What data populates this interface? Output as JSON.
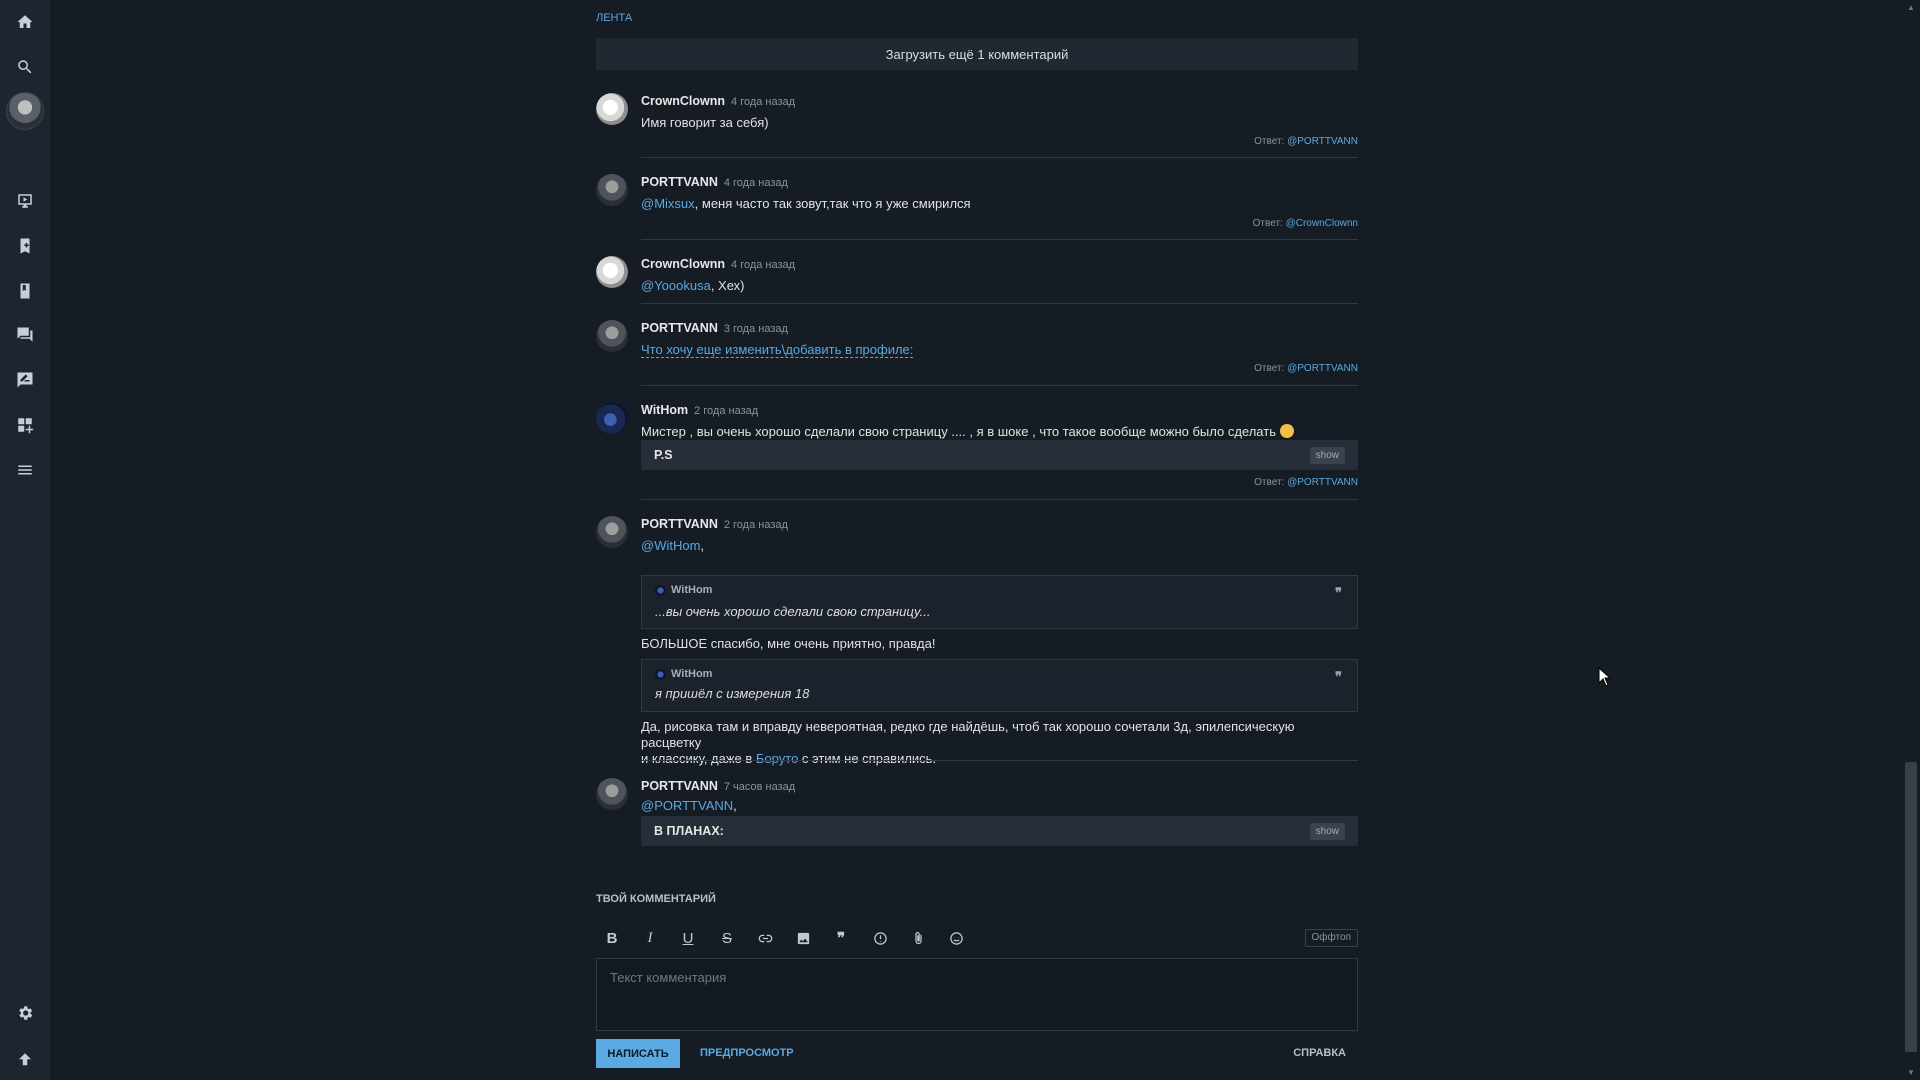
{
  "sidebar": {
    "items": [
      {
        "name": "home",
        "icon": "home-icon"
      },
      {
        "name": "search",
        "icon": "search-icon"
      },
      {
        "name": "watch",
        "icon": "tv-icon"
      },
      {
        "name": "bookmarks",
        "icon": "bookmark-icon"
      },
      {
        "name": "library",
        "icon": "book-icon"
      },
      {
        "name": "forum",
        "icon": "forum-icon"
      },
      {
        "name": "messages",
        "icon": "message-edit-icon"
      },
      {
        "name": "catalog",
        "icon": "grid-icon"
      },
      {
        "name": "menu",
        "icon": "menu-icon"
      },
      {
        "name": "settings",
        "icon": "gear-icon"
      },
      {
        "name": "scroll-top",
        "icon": "arrow-up-icon"
      }
    ]
  },
  "feed": {
    "label": "ЛЕНТА"
  },
  "load_more": "Загрузить ещё 1 комментарий",
  "comments": [
    {
      "author": "CrownClownn",
      "time": "4 года назад",
      "text": "Имя говорит за себя)",
      "reply_label": "Ответ:",
      "reply_to": "@PORTTVANN"
    },
    {
      "author": "PORTTVANN",
      "time": "4 года назад",
      "mention": "@Mixsux",
      "text": ", меня часто так зовут,так что я уже смирился",
      "reply_label": "Ответ:",
      "reply_to": "@CrownClownn"
    },
    {
      "author": "CrownClownn",
      "time": "4 года назад",
      "mention": "@Yoookusa",
      "text": ", Хех)"
    },
    {
      "author": "PORTTVANN",
      "time": "3 года назад",
      "link_text": "Что хочу еще изменить\\добавить в профиле:",
      "reply_label": "Ответ:",
      "reply_to": "@PORTTVANN"
    },
    {
      "author": "WitHom",
      "time": "2 года назад",
      "text": "Мистер , вы очень хорошо сделали свою страницу .... , я в шоке , что такое вообще можно было сделать",
      "spoiler_title": "P.S",
      "spoiler_btn": "show",
      "reply_label": "Ответ:",
      "reply_to": "@PORTTVANN"
    },
    {
      "author": "PORTTVANN",
      "time": "2 года назад",
      "mention": "@WitHom",
      "text": ",",
      "quote1": {
        "author": "WitHom",
        "text": "...вы очень хорошо сделали свою страницу..."
      },
      "text2": "БОЛЬШОЕ спасибо, мне очень приятно, правда!",
      "quote2": {
        "author": "WitHom",
        "text": "я пришёл с измерения 18"
      },
      "text3a": "Да, рисовка там и вправду невероятная, редко где найдёшь, чтоб так хорошо сочетали 3д, эпилепсическую расцветку",
      "text3b": "и классику, даже в ",
      "text3_link": "Боруто",
      "text3c": " с этим не справились."
    },
    {
      "author": "PORTTVANN",
      "time": "7 часов назад",
      "mention": "@PORTTVANN",
      "text": ",",
      "spoiler_title": "В ПЛАНАХ:",
      "spoiler_btn": "show"
    }
  ],
  "quote_mark": "❞",
  "form": {
    "title": "ТВОЙ КОММЕНТАРИЙ",
    "placeholder": "Текст комментария",
    "offtop": "Оффтоп",
    "submit": "НАПИСАТЬ",
    "preview": "ПРЕДПРОСМОТР",
    "help": "СПРАВКА",
    "toolbar": {
      "bold": "B",
      "italic": "I",
      "underline": "U",
      "strike": "S"
    }
  },
  "colors": {
    "background": "#161c24",
    "sidebar": "#1d2530",
    "accent": "#5aa9e0"
  }
}
